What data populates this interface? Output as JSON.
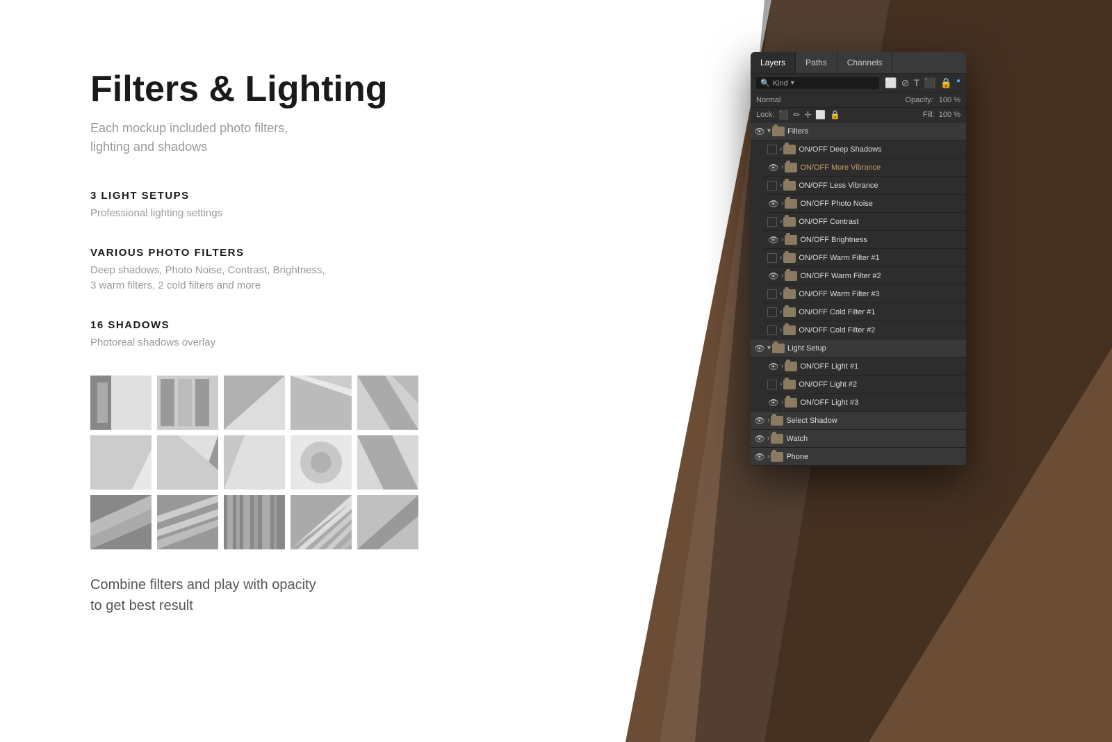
{
  "background": {
    "corner_color": "#6b4c35"
  },
  "left": {
    "title": "Filters & Lighting",
    "subtitle": "Each mockup included photo filters,\nlighting and shadows",
    "sections": [
      {
        "label": "3 Light Setups",
        "desc": "Professional lighting settings"
      },
      {
        "label": "Various Photo Filters",
        "desc": "Deep shadows, Photo Noise, Contrast, Brightness,\n3 warm filters, 2 cold filters and more"
      },
      {
        "label": "16 Shadows",
        "desc": "Photoreal shadows overlay"
      }
    ],
    "combine_text": "Combine filters and play with opacity\nto get best result"
  },
  "panel": {
    "tabs": [
      "Layers",
      "Paths",
      "Channels"
    ],
    "active_tab": "Layers",
    "search_placeholder": "Kind",
    "blend_mode": "Normal",
    "opacity_label": "Opacity:",
    "lock_label": "Lock:",
    "fill_label": "Fill:",
    "layers": [
      {
        "type": "group_header",
        "name": "Filters",
        "visible": true,
        "expanded": true
      },
      {
        "type": "group",
        "name": "ON/OFF Deep Shadows",
        "visible": false,
        "indent": true
      },
      {
        "type": "group",
        "name": "ON/OFF More Vibrance",
        "visible": true,
        "indent": true,
        "vibrance": true
      },
      {
        "type": "group",
        "name": "ON/OFF Less Vibrance",
        "visible": false,
        "indent": true
      },
      {
        "type": "group",
        "name": "ON/OFF Photo Noise",
        "visible": true,
        "indent": true
      },
      {
        "type": "group",
        "name": "ON/OFF Contrast",
        "visible": false,
        "indent": true
      },
      {
        "type": "group",
        "name": "ON/OFF Brightness",
        "visible": true,
        "indent": true
      },
      {
        "type": "group",
        "name": "ON/OFF Warm Filter #1",
        "visible": false,
        "indent": true
      },
      {
        "type": "group",
        "name": "ON/OFF Warm Filter #2",
        "visible": true,
        "indent": true
      },
      {
        "type": "group",
        "name": "ON/OFF Warm Filter #3",
        "visible": false,
        "indent": true
      },
      {
        "type": "group",
        "name": "ON/OFF Cold Filter #1",
        "visible": false,
        "indent": true
      },
      {
        "type": "group",
        "name": "ON/OFF Cold Filter #2",
        "visible": false,
        "indent": true
      },
      {
        "type": "group_header",
        "name": "Light Setup",
        "visible": true,
        "expanded": true
      },
      {
        "type": "group",
        "name": "ON/OFF Light #1",
        "visible": true,
        "indent": true
      },
      {
        "type": "group",
        "name": "ON/OFF Light #2",
        "visible": false,
        "indent": true
      },
      {
        "type": "group",
        "name": "ON/OFF Light #3",
        "visible": true,
        "indent": true
      },
      {
        "type": "group_header",
        "name": "Select Shadow",
        "visible": true,
        "expanded": false
      },
      {
        "type": "group_header",
        "name": "Watch",
        "visible": true,
        "expanded": false
      },
      {
        "type": "group_header",
        "name": "Phone",
        "visible": true,
        "expanded": false
      }
    ]
  }
}
